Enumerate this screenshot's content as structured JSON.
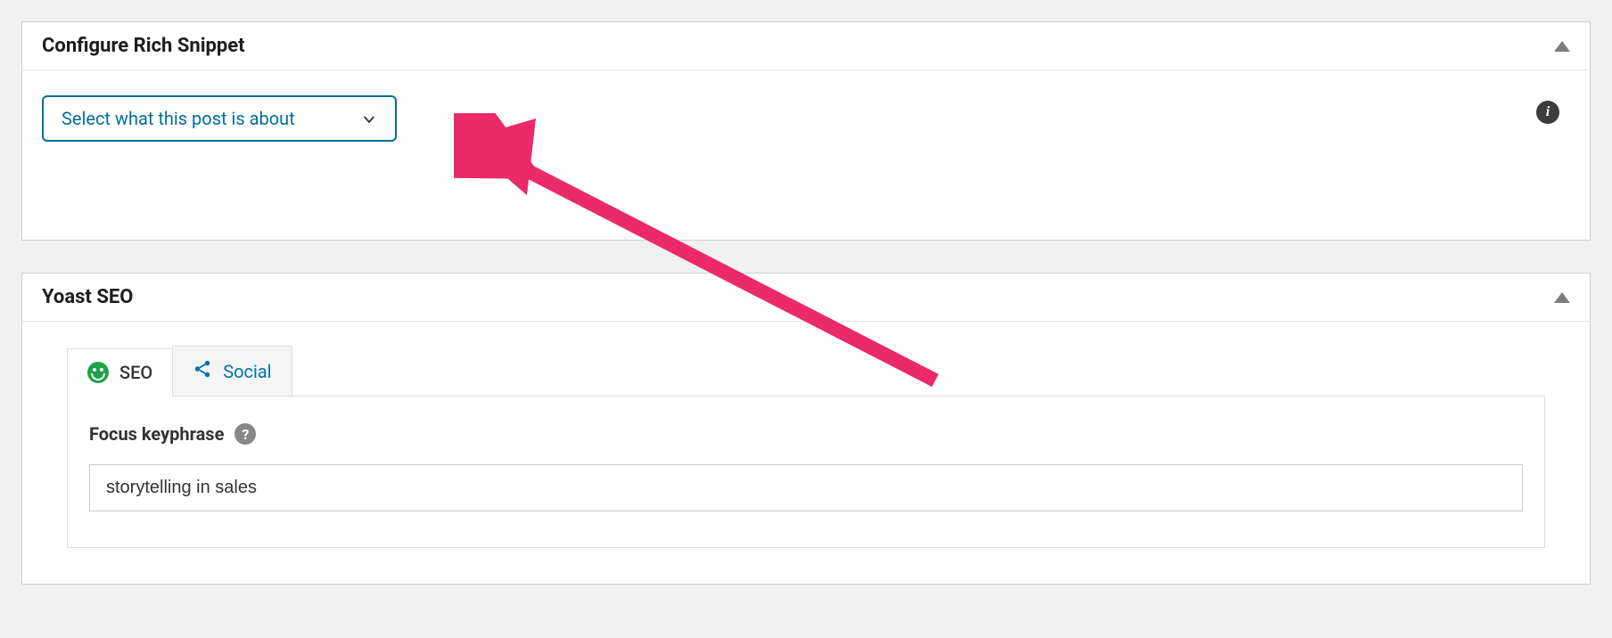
{
  "rich_snippet": {
    "title": "Configure Rich Snippet",
    "select_placeholder": "Select what this post is about",
    "info_icon": "i"
  },
  "yoast": {
    "title": "Yoast SEO",
    "tabs": {
      "seo": "SEO",
      "social": "Social"
    },
    "focus_keyphrase_label": "Focus keyphrase",
    "focus_keyphrase_value": "storytelling in sales",
    "help_icon": "?"
  },
  "colors": {
    "accent_blue": "#006e9c",
    "link_blue": "#0073aa",
    "good_green": "#1fa24a",
    "annotation_pink": "#e91e63"
  }
}
